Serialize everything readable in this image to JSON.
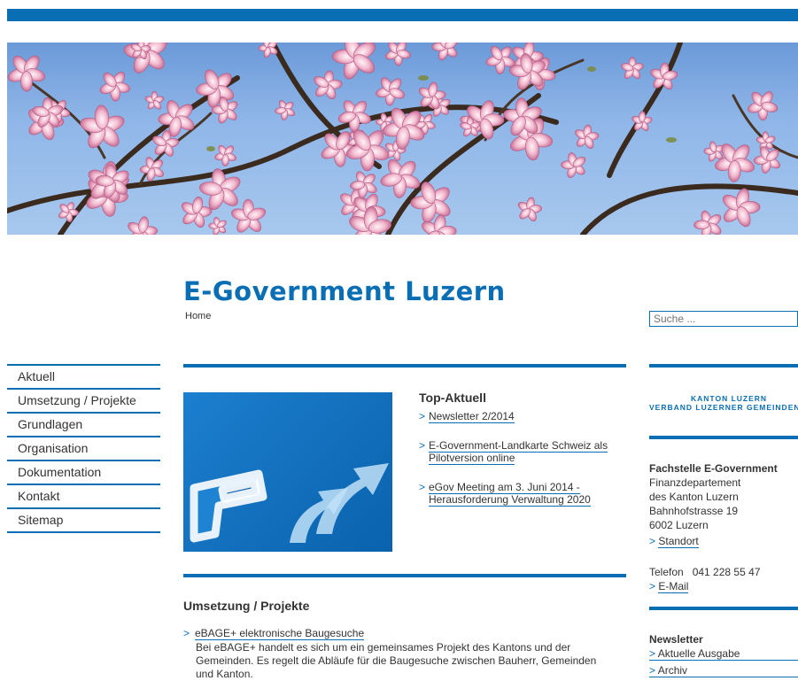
{
  "header": {
    "site_title": "E-Government Luzern",
    "breadcrumb": "Home",
    "search_placeholder": "Suche ..."
  },
  "nav": {
    "items": [
      {
        "label": "Aktuell"
      },
      {
        "label": "Umsetzung / Projekte"
      },
      {
        "label": "Grundlagen"
      },
      {
        "label": "Organisation"
      },
      {
        "label": "Dokumentation"
      },
      {
        "label": "Kontakt"
      },
      {
        "label": "Sitemap"
      }
    ]
  },
  "top_aktuell": {
    "title": "Top-Aktuell",
    "items": [
      {
        "label": "Newsletter 2/2014"
      },
      {
        "label_line1": "E-Government-Landkarte Schweiz als",
        "label_line2": "Pilotversion online"
      },
      {
        "label_line1": "eGov Meeting am 3. Juni 2014 -",
        "label_line2": "Herausforderung Verwaltung 2020"
      }
    ]
  },
  "projekte": {
    "title": "Umsetzung / Projekte",
    "item_label": "eBAGE+ elektronische Baugesuche",
    "item_desc_line1": "Bei eBAGE+ handelt es sich um ein gemeinsames Projekt des Kantons und der",
    "item_desc_line2": "Gemeinden. Es regelt die Abläufe für die Baugesuche zwischen Bauherr, Gemeinden",
    "item_desc_line3": "und Kanton."
  },
  "sidebar": {
    "logo_line1": "KANTON LUZERN",
    "logo_line2": "VERBAND LUZERNER GEMEINDEN",
    "contact": {
      "title": "Fachstelle E-Government",
      "line1": "Finanzdepartement",
      "line2": "des Kanton Luzern",
      "line3": "Bahnhofstrasse 19",
      "line4": "6002 Luzern",
      "standort_label": "Standort",
      "phone": "Telefon   041 228 55 47",
      "email_label": "E-Mail"
    },
    "newsletter": {
      "title": "Newsletter",
      "current_label": "Aktuelle Ausgabe",
      "archive_label": "Archiv"
    }
  },
  "colors": {
    "brand_blue": "#0a6eb4",
    "text": "#333333"
  }
}
